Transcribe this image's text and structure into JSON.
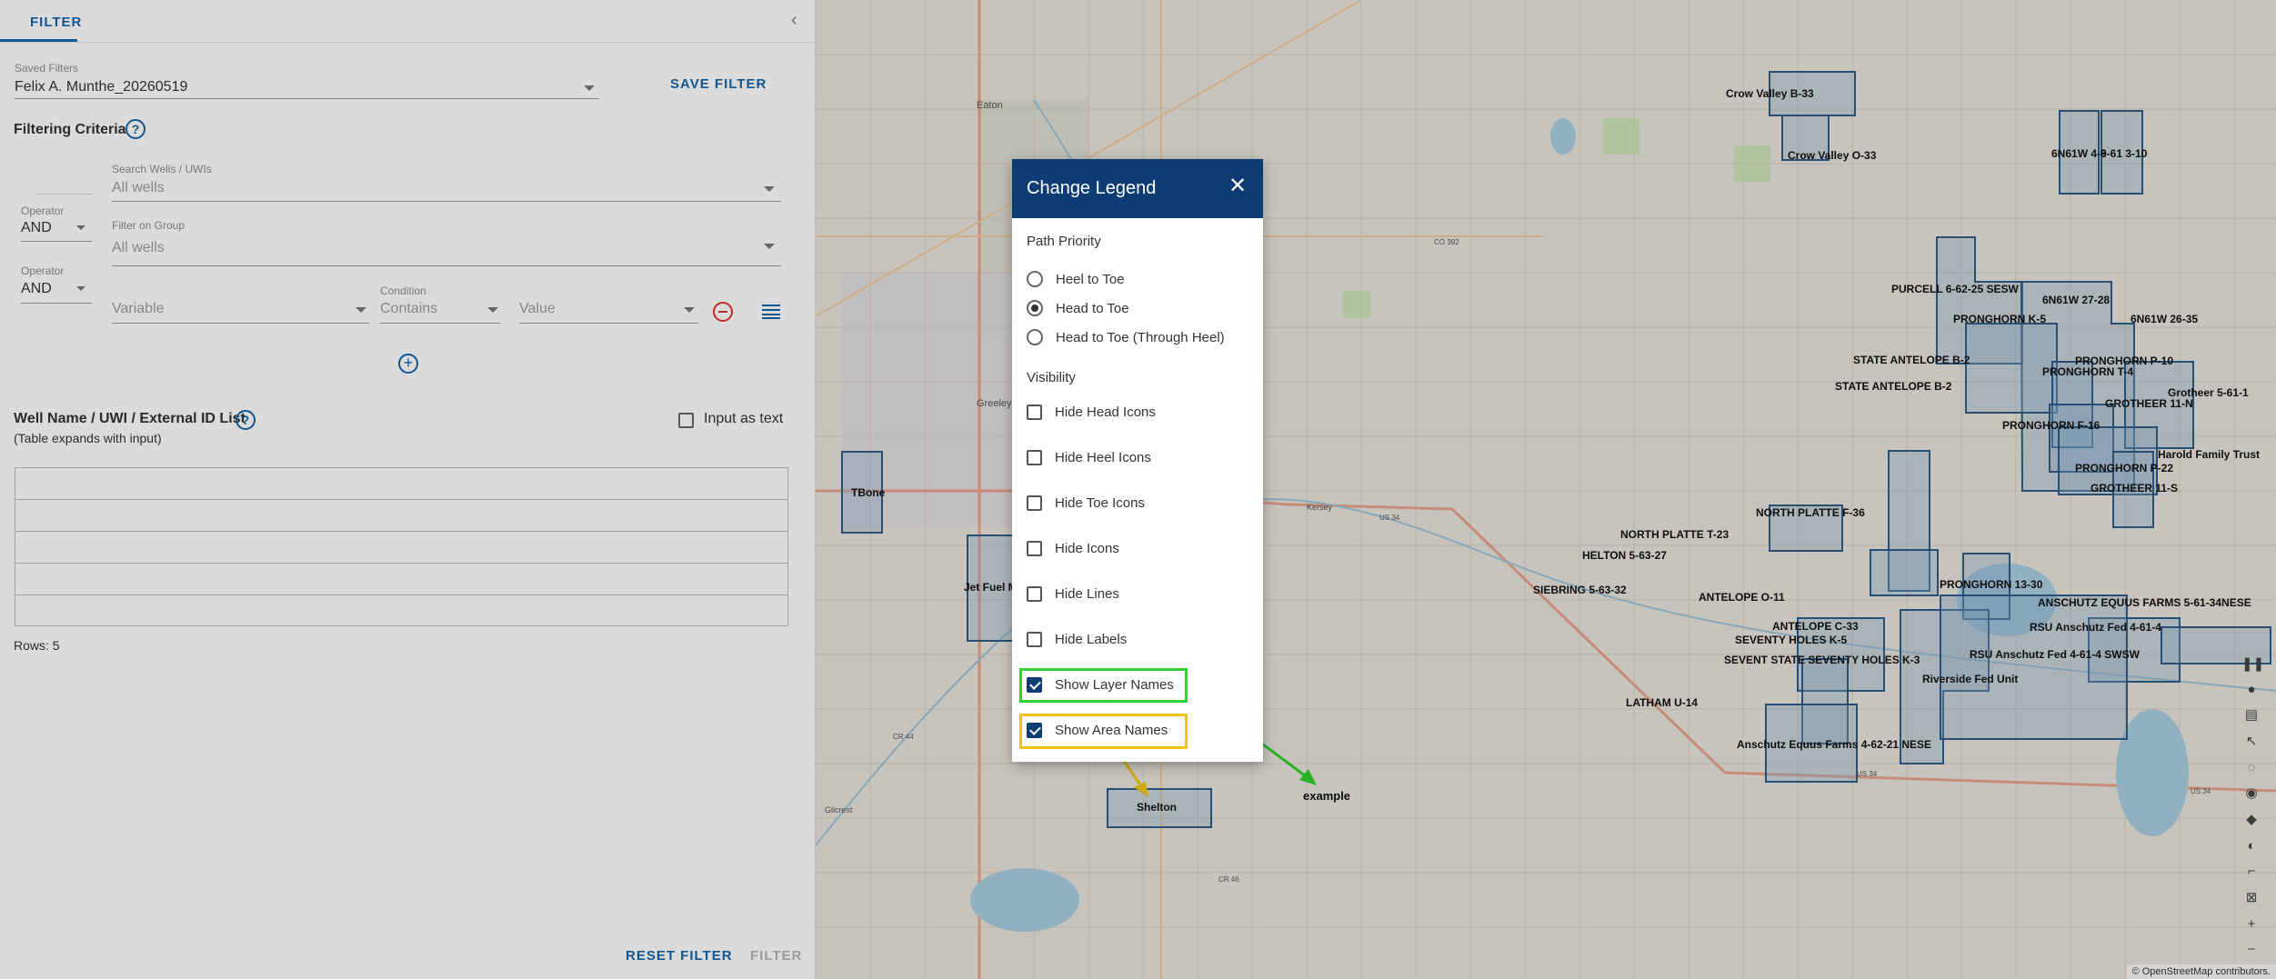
{
  "filter_panel": {
    "tab_label": "FILTER",
    "saved_filters_label": "Saved Filters",
    "saved_filter_value": "Felix A. Munthe_20260519",
    "save_filter_label": "SAVE FILTER",
    "filtering_criteria_title": "Filtering Criteria",
    "search_wells_label": "Search Wells / UWIs",
    "search_wells_placeholder": "All wells",
    "operator_label": "Operator",
    "operator_value": "AND",
    "filter_group_label": "Filter on Group",
    "filter_group_placeholder": "All wells",
    "operator2_label": "Operator",
    "operator2_value": "AND",
    "variable_placeholder": "Variable",
    "condition_label": "Condition",
    "condition_value": "Contains",
    "value_placeholder": "Value",
    "well_list_title": "Well Name / UWI / External ID List",
    "well_list_subtitle": "(Table expands with input)",
    "input_as_text_label": "Input as text",
    "rows_label": "Rows: 5",
    "reset_filter_label": "RESET FILTER",
    "filter_button_label": "FILTER"
  },
  "dialog": {
    "title": "Change Legend",
    "path_priority_label": "Path Priority",
    "path_options": [
      {
        "label": "Heel to Toe",
        "selected": false
      },
      {
        "label": "Head to Toe",
        "selected": true
      },
      {
        "label": "Head to Toe (Through Heel)",
        "selected": false
      }
    ],
    "visibility_label": "Visibility",
    "visibility_options": [
      {
        "label": "Hide Head Icons",
        "checked": false
      },
      {
        "label": "Hide Heel Icons",
        "checked": false
      },
      {
        "label": "Hide Toe Icons",
        "checked": false
      },
      {
        "label": "Hide Icons",
        "checked": false
      },
      {
        "label": "Hide Lines",
        "checked": false
      },
      {
        "label": "Hide Labels",
        "checked": false
      },
      {
        "label": "Show Layer Names",
        "checked": true
      },
      {
        "label": "Show Area Names",
        "checked": true
      }
    ]
  },
  "map": {
    "area_labels": [
      "Crow Valley B-33",
      "Crow Valley O-33",
      "6N61W 4-9",
      "6-61 3-10",
      "PURCELL 6-62-25 SESW",
      "6N61W 27-28",
      "PRONGHORN K-5",
      "6N61W 26-35",
      "STATE ANTELOPE B-2",
      "STATE ANTELOPE B-2",
      "PRONGHORN P-10",
      "PRONGHORN T-4",
      "Grotheer 5-61-1",
      "GROTHEER 11-N",
      "PRONGHORN F-16",
      "Harold Family Trust",
      "PRONGHORN P-22",
      "GROTHEER 11-S",
      "NORTH PLATTE F-36",
      "NORTH PLATTE T-23",
      "HELTON 5-63-27",
      "SIEBRING 5-63-32",
      "ANTELOPE O-11",
      "PRONGHORN 13-30",
      "ANSCHUTZ EQUUS FARMS 5-61-34NESE",
      "ANTELOPE C-33",
      "RSU Anschutz Fed 4-61-4",
      "SEVENTY HOLES K-5",
      "RSU Anschutz Fed 4-61-4 SWSW",
      "SEVENT STATE SEVENTY HOLES K-3",
      "Riverside Fed Unit",
      "LATHAM U-14",
      "Anschutz Equus Farms 4-62-21 NESE",
      "TBone",
      "Jet Fuel M",
      "Shelton",
      "example"
    ],
    "town_labels": [
      "Eaton",
      "Greeley",
      "Kersey",
      "Gilcrest"
    ],
    "road_labels": [
      "US 34",
      "CO 392",
      "US 34",
      "US 34",
      "CR 44",
      "CR 46"
    ],
    "attribution": "© OpenStreetMap contributors."
  },
  "colors": {
    "brand_blue": "#0d3c74",
    "accent_blue": "#1565a8",
    "highlight_green": "#2fd02f",
    "highlight_yellow": "#f1c40f",
    "remove_red": "#dd3333"
  }
}
